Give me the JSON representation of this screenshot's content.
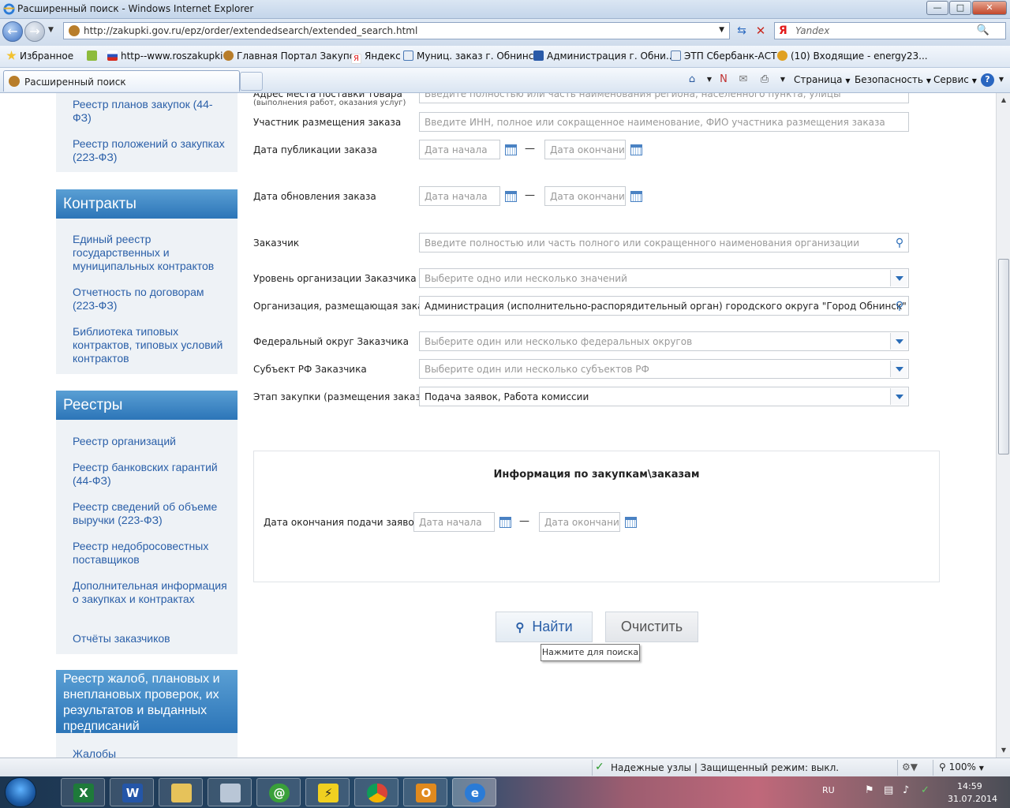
{
  "window": {
    "title": "Расширенный поиск - Windows Internet Explorer",
    "minimize": "0",
    "maximize": "1",
    "close": "r"
  },
  "address": {
    "url": "http://zakupki.gov.ru/epz/order/extendedsearch/extended_search.html",
    "search_engine": "Я",
    "search_placeholder": "Yandex"
  },
  "favorites": {
    "label": "Избранное",
    "items": [
      {
        "label": "http--www.roszakupki",
        "color": "#3c7bd6"
      },
      {
        "label": "Главная Портал Закупок",
        "color": "#b87d2a"
      },
      {
        "label": "Яндекс",
        "color": "#e31b1b"
      },
      {
        "label": "Муниц. заказ г. Обнинск",
        "color": "#4877b5"
      },
      {
        "label": "Администрация г. Обни...",
        "color": "#2a5aa8"
      },
      {
        "label": "ЭТП Сбербанк-АСТ",
        "color": "#5a7fb0"
      },
      {
        "label": "(10) Входящие - energy23...",
        "color": "#e0a020"
      }
    ]
  },
  "tab": {
    "label": "Расширенный поиск"
  },
  "commands": {
    "page": "Страница",
    "safety": "Безопасность",
    "tools": "Сервис"
  },
  "sidebar": {
    "top_items": [
      {
        "label": "Реестр планов закупок (44-ФЗ)"
      },
      {
        "label": "Реестр положений о закупках (223-ФЗ)"
      }
    ],
    "contracts": {
      "title": "Контракты",
      "items": [
        {
          "label": "Единый реестр государственных и муниципальных контрактов"
        },
        {
          "label": "Отчетность по договорам (223-ФЗ)"
        },
        {
          "label": "Библиотека типовых контрактов, типовых условий контрактов"
        }
      ]
    },
    "registries": {
      "title": "Реестры",
      "items": [
        {
          "label": "Реестр организаций"
        },
        {
          "label": "Реестр банковских гарантий (44-ФЗ)"
        },
        {
          "label": "Реестр сведений об объеме выручки (223-ФЗ)"
        },
        {
          "label": "Реестр недобросовестных поставщиков"
        },
        {
          "label": "Дополнительная информация о закупках и контрактах"
        },
        {
          "label": "Отчёты заказчиков"
        }
      ]
    },
    "complaints": {
      "title": "Реестр жалоб, плановых и внеплановых проверок, их результатов и выданных предписаний",
      "items": [
        {
          "label": "Жалобы"
        }
      ]
    }
  },
  "form": {
    "delivery_address": {
      "label": "Адрес места поставки товара",
      "sublabel": "(выполнения работ, оказания услуг)",
      "placeholder": "Введите полностью или часть наименования региона, населенного пункта, улицы"
    },
    "participant": {
      "label": "Участник размещения заказа",
      "placeholder": "Введите ИНН, полное или сокращенное наименование, ФИО участника размещения заказа"
    },
    "publish_date": {
      "label": "Дата публикации заказа",
      "from": "Дата начала",
      "to": "Дата окончания"
    },
    "update_date": {
      "label": "Дата обновления заказа",
      "from": "Дата начала",
      "to": "Дата окончания"
    },
    "customer": {
      "label": "Заказчик",
      "placeholder": "Введите полностью или часть полного или сокращенного наименования организации"
    },
    "customer_level": {
      "label": "Уровень организации Заказчика",
      "placeholder": "Выберите одно или несколько значений"
    },
    "placing_org": {
      "label": "Организация, размещающая заказ",
      "value": "Администрация (исполнительно-распорядительный орган) городского округа \"Город Обнинск\""
    },
    "federal_district": {
      "label": "Федеральный округ Заказчика",
      "placeholder": "Выберите один или несколько федеральных округов"
    },
    "region": {
      "label": "Субъект РФ Заказчика",
      "placeholder": "Выберите один или несколько субъектов РФ"
    },
    "stage": {
      "label": "Этап закупки (размещения заказа)",
      "value": "Подача заявок, Работа комиссии"
    },
    "dash": "—"
  },
  "info": {
    "title": "Информация по закупкам\\заказам",
    "deadline": {
      "label": "Дата окончания подачи заявок",
      "from": "Дата начала",
      "to": "Дата окончания"
    }
  },
  "buttons": {
    "find": "Найти",
    "clear": "Очистить",
    "tooltip": "Нажмите для поиска"
  },
  "statusbar": {
    "zone": "Надежные узлы | Защищенный режим: выкл.",
    "zoom": "100%"
  },
  "taskbar": {
    "lang": "RU",
    "time": "14:59",
    "date": "31.07.2014"
  }
}
